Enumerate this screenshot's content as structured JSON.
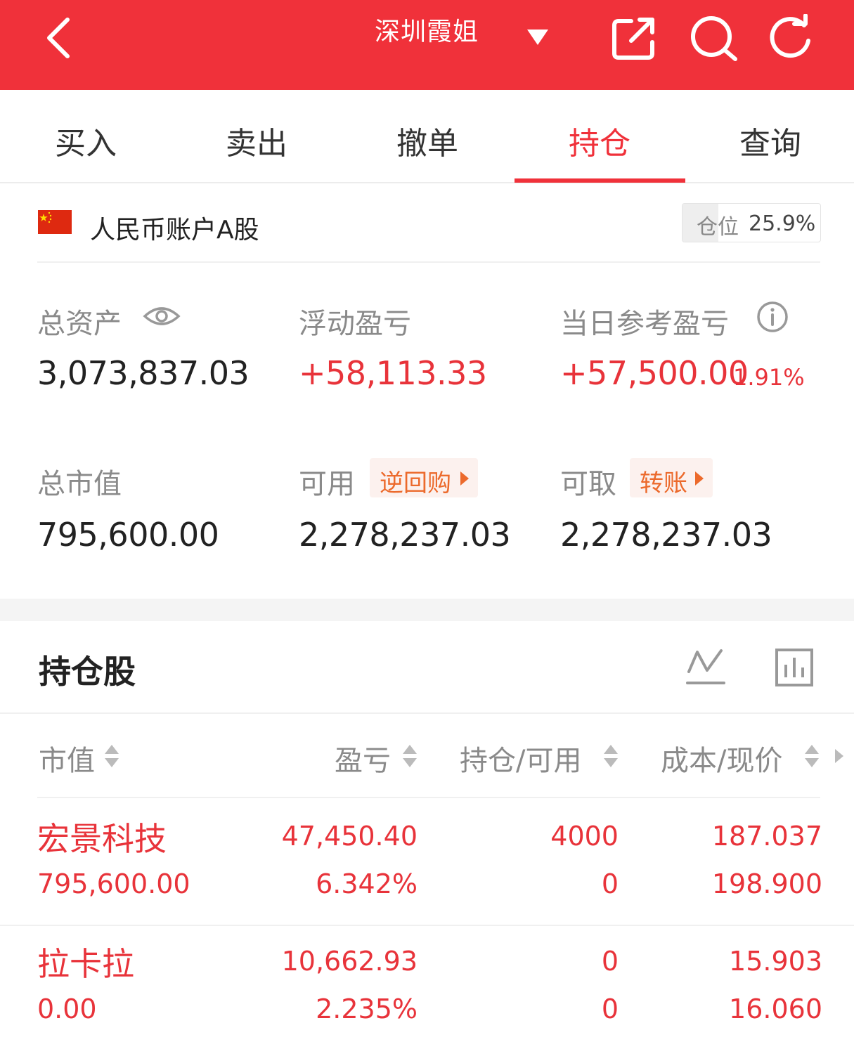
{
  "header": {
    "account_title": "深圳霞姐",
    "bg_color": "#f0313a"
  },
  "tabs": [
    {
      "label": "买入",
      "active": false
    },
    {
      "label": "卖出",
      "active": false
    },
    {
      "label": "撤单",
      "active": false
    },
    {
      "label": "持仓",
      "active": true
    },
    {
      "label": "查询",
      "active": false
    }
  ],
  "account": {
    "name": "人民币账户A股",
    "position_label": "仓位",
    "position_value": "25.9%",
    "position_fraction": 0.259
  },
  "summary": {
    "total_assets_label": "总资产",
    "total_assets": "3,073,837.03",
    "floating_pl_label": "浮动盈亏",
    "floating_pl": "+58,113.33",
    "daily_pl_label": "当日参考盈亏",
    "daily_pl": "+57,500.00",
    "daily_pl_pct": "1.91%",
    "market_value_label": "总市值",
    "market_value": "795,600.00",
    "available_label": "可用",
    "reverse_repo_label": "逆回购",
    "available": "2,278,237.03",
    "withdrawable_label": "可取",
    "transfer_label": "转账",
    "withdrawable": "2,278,237.03"
  },
  "holdings": {
    "title": "持仓股",
    "columns": [
      "市值",
      "盈亏",
      "持仓/可用",
      "成本/现价"
    ],
    "rows": [
      {
        "name": "宏景科技",
        "market_value": "795,600.00",
        "pl": "47,450.40",
        "pl_pct": "6.342%",
        "position": "4000",
        "available": "0",
        "cost": "187.037",
        "price": "198.900"
      },
      {
        "name": "拉卡拉",
        "market_value": "0.00",
        "pl": "10,662.93",
        "pl_pct": "2.235%",
        "position": "0",
        "available": "0",
        "cost": "15.903",
        "price": "16.060"
      }
    ]
  },
  "colors": {
    "accent": "#f0313a",
    "profit": "#e8333a",
    "chip_text": "#ec6a2c"
  }
}
